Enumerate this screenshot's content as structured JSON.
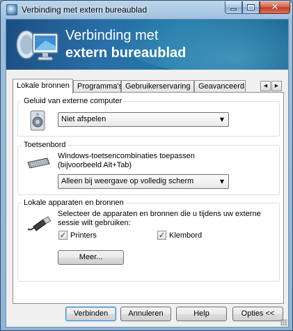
{
  "window": {
    "title": "Verbinding met extern bureaublad"
  },
  "banner": {
    "line1": "Verbinding met",
    "line2": "extern bureaublad"
  },
  "tabs": [
    {
      "label": "Lokale bronnen",
      "active": true
    },
    {
      "label": "Programma's",
      "active": false
    },
    {
      "label": "Gebruikerservaring",
      "active": false
    },
    {
      "label": "Geavanceerd",
      "active": false
    }
  ],
  "tab_scroll": {
    "left": "◀",
    "right": "▶"
  },
  "groups": {
    "audio": {
      "label": "Geluid van externe computer",
      "icon": "speaker-icon",
      "select_value": "Niet afspelen"
    },
    "keyboard": {
      "label": "Toetsenbord",
      "icon": "keyboard-icon",
      "text_line1": "Windows-toetsencombinaties toepassen",
      "text_line2": "(bijvoorbeeld Alt+Tab)",
      "select_value": "Alleen bij weergave op volledig scherm"
    },
    "devices": {
      "label": "Lokale apparaten en bronnen",
      "icon": "usb-plug-icon",
      "text_line1": "Selecteer de apparaten en bronnen die u tijdens uw externe",
      "text_line2": "sessie wilt gebruiken:",
      "printers_label": "Printers",
      "printers_checked": true,
      "clipboard_label": "Klembord",
      "clipboard_checked": true,
      "more_button": "Meer..."
    }
  },
  "buttons": {
    "connect": "Verbinden",
    "cancel": "Annuleren",
    "help": "Help",
    "options": "Opties <<"
  },
  "glyphs": {
    "check": "✓",
    "dropdown": "▼",
    "close": "✕"
  }
}
